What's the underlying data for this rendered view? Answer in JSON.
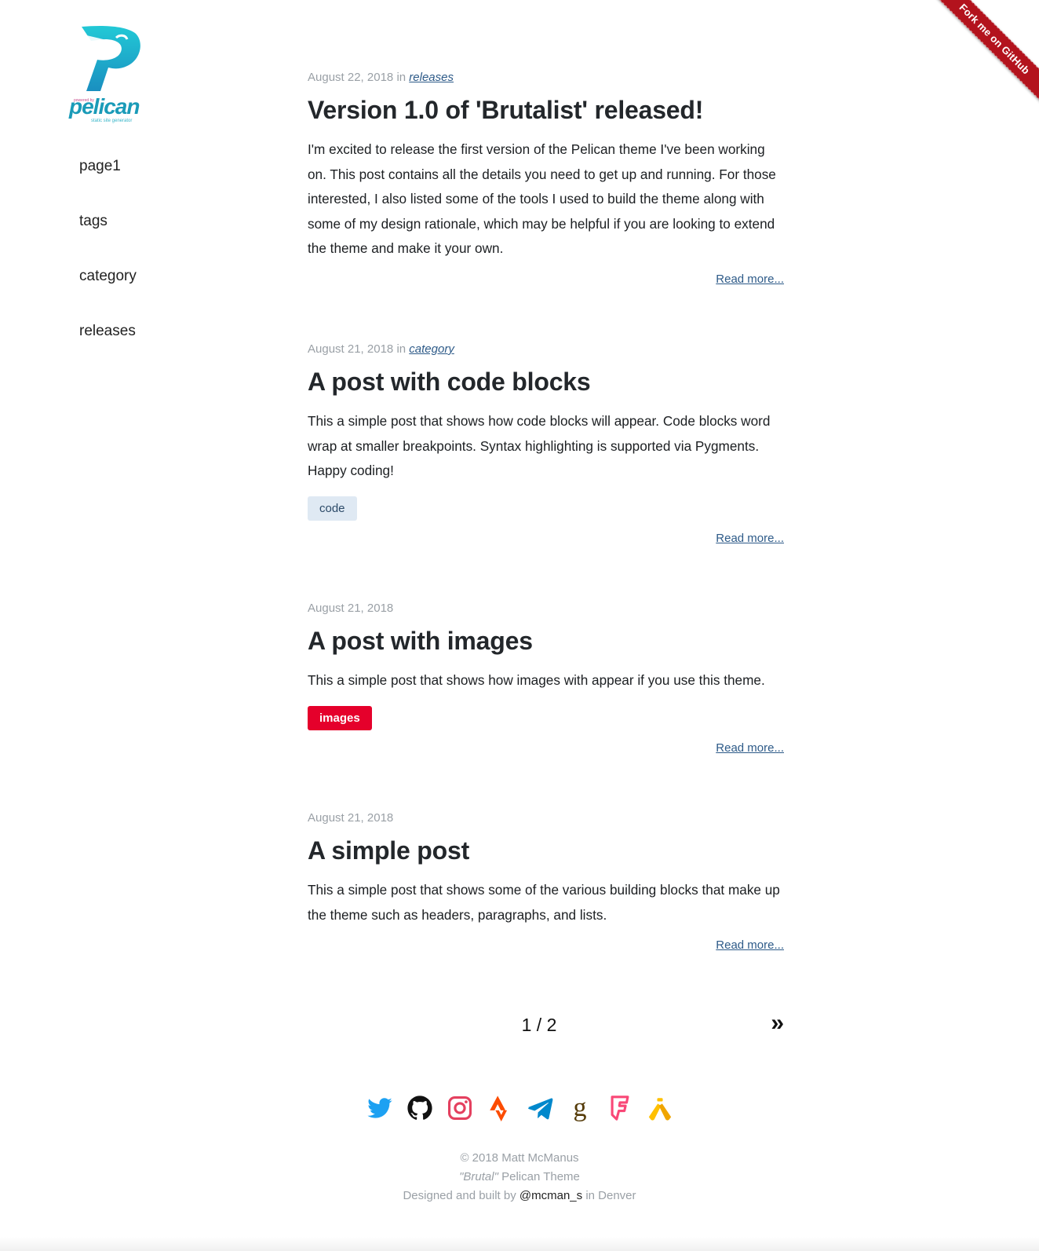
{
  "ribbon": {
    "label": "Fork me on GitHub",
    "color": "#b3131d"
  },
  "logo": {
    "word": "pelican",
    "pre": "powered by",
    "sub": "static site generator",
    "color": "#1a9bb8"
  },
  "nav": [
    {
      "label": "page1"
    },
    {
      "label": "tags"
    },
    {
      "label": "category"
    },
    {
      "label": "releases"
    }
  ],
  "posts": [
    {
      "date": "August 22, 2018",
      "in": "in",
      "category": "releases",
      "title": "Version 1.0 of 'Brutalist' released!",
      "body": "I'm excited to release the first version of the Pelican theme I've been working on. This post contains all the details you need to get up and running. For those interested, I also listed some of the tools I used to build the theme along with some of my design rationale, which may be helpful if you are looking to extend the theme and make it your own.",
      "read_more": "Read more..."
    },
    {
      "date": "August 21, 2018",
      "in": "in",
      "category": "category",
      "title": "A post with code blocks",
      "body": "This a simple post that shows how code blocks will appear. Code blocks word wrap at smaller breakpoints. Syntax highlighting is supported via Pygments. Happy coding!",
      "tag": "code",
      "read_more": "Read more..."
    },
    {
      "date": "August 21, 2018",
      "title": "A post with images",
      "body": "This a simple post that shows how images with appear if you use this theme.",
      "tag": "images",
      "read_more": "Read more..."
    },
    {
      "date": "August 21, 2018",
      "title": "A simple post",
      "body": "This a simple post that shows some of the various building blocks that make up the theme such as headers, paragraphs, and lists.",
      "read_more": "Read more..."
    }
  ],
  "pager": {
    "current": "1 / 2",
    "next": "»"
  },
  "social": [
    {
      "icon": "twitter-icon",
      "color": "#1da1f2"
    },
    {
      "icon": "github-icon",
      "color": "#111111"
    },
    {
      "icon": "instagram-icon",
      "color": "#e4405f"
    },
    {
      "icon": "strava-icon",
      "color": "#fc4c02"
    },
    {
      "icon": "telegram-icon",
      "color": "#0088cc"
    },
    {
      "icon": "goodreads-icon",
      "color": "#553b08"
    },
    {
      "icon": "foursquare-icon",
      "color": "#f94877"
    },
    {
      "icon": "untappd-icon",
      "color": "#ffc000"
    }
  ],
  "footer": {
    "copyright": "© 2018 Matt McManus",
    "theme_em": "\"Brutal\"",
    "theme_rest": " Pelican Theme",
    "built_pre": "Designed and built by ",
    "handle": "@mcman_s",
    "built_post": " in Denver"
  }
}
